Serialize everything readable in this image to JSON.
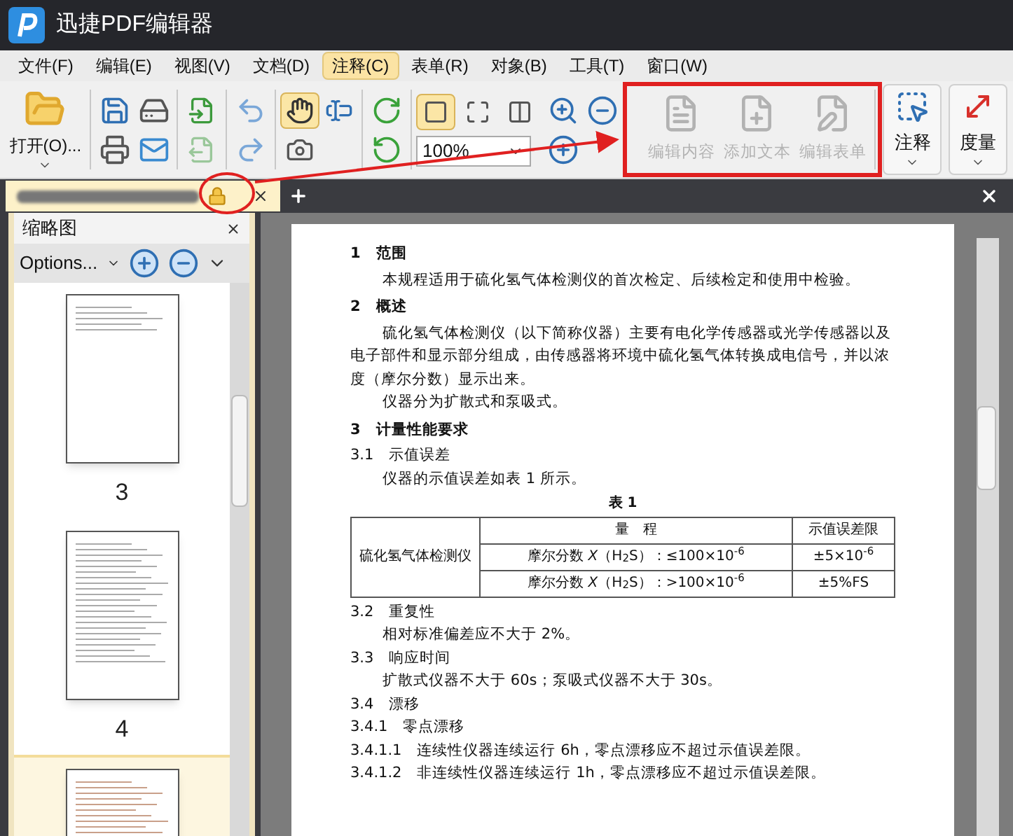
{
  "app": {
    "title": "迅捷PDF编辑器"
  },
  "menu": [
    {
      "label": "文件(F)",
      "selected": false
    },
    {
      "label": "编辑(E)",
      "selected": false
    },
    {
      "label": "视图(V)",
      "selected": false
    },
    {
      "label": "文档(D)",
      "selected": false
    },
    {
      "label": "注释(C)",
      "selected": true
    },
    {
      "label": "表单(R)",
      "selected": false
    },
    {
      "label": "对象(B)",
      "selected": false
    },
    {
      "label": "工具(T)",
      "selected": false
    },
    {
      "label": "窗口(W)",
      "selected": false
    }
  ],
  "toolbar": {
    "open_label": "打开(O)...",
    "zoom_value": "100%",
    "hand_selected": true,
    "actual_size_selected": true,
    "edit_buttons": [
      {
        "label": "编辑内容",
        "disabled": true
      },
      {
        "label": "添加文本",
        "disabled": true
      },
      {
        "label": "编辑表单",
        "disabled": true
      }
    ],
    "right_buttons": [
      {
        "label": "注释",
        "kind": "annotate"
      },
      {
        "label": "度量",
        "kind": "measure"
      }
    ]
  },
  "tab": {
    "locked": true
  },
  "sidebar": {
    "title": "缩略图",
    "options_label": "Options...",
    "thumbnails": [
      {
        "label": "3",
        "selected": false,
        "kind": "cover"
      },
      {
        "label": "4",
        "selected": false,
        "kind": "contents"
      },
      {
        "selected": true,
        "kind": "text"
      }
    ]
  },
  "document": {
    "blocks": [
      {
        "kind": "heading",
        "text": "1　范围"
      },
      {
        "kind": "para",
        "text": "本规程适用于硫化氢气体检测仪的首次检定、后续检定和使用中检验。"
      },
      {
        "kind": "heading",
        "text": "2　概述"
      },
      {
        "kind": "para",
        "text": "硫化氢气体检测仪（以下简称仪器）主要有电化学传感器或光学传感器以及电子部件和显示部分组成，由传感器将环境中硫化氢气体转换成电信号，并以浓度（摩尔分数）显示出来。"
      },
      {
        "kind": "para",
        "text": "仪器分为扩散式和泵吸式。"
      },
      {
        "kind": "heading",
        "text": "3　计量性能要求"
      },
      {
        "kind": "sub",
        "text": "3.1　示值误差"
      },
      {
        "kind": "para",
        "text": "仪器的示值误差如表 1 所示。"
      },
      {
        "kind": "table",
        "caption": "表 1",
        "header": [
          "量　程",
          "示值误差限"
        ],
        "row_label": "硫化氢气体检测仪",
        "rows": [
          [
            "摩尔分数 *X*（H$_{2}$S）：≤100×10$^{-6}$",
            "±5×10$^{-6}$"
          ],
          [
            "摩尔分数 *X*（H$_{2}$S）：>100×10$^{-6}$",
            "±5%FS"
          ]
        ]
      },
      {
        "kind": "sub",
        "text": "3.2　重复性"
      },
      {
        "kind": "para",
        "text": "相对标准偏差应不大于 2%。"
      },
      {
        "kind": "sub",
        "text": "3.3　响应时间"
      },
      {
        "kind": "para",
        "text": "扩散式仪器不大于 60s；泵吸式仪器不大于 30s。"
      },
      {
        "kind": "sub",
        "text": "3.4　漂移"
      },
      {
        "kind": "sub",
        "text": "3.4.1　零点漂移"
      },
      {
        "kind": "sub",
        "text": "3.4.1.1　连续性仪器连续运行 6h，零点漂移应不超过示值误差限。"
      },
      {
        "kind": "sub",
        "text": "3.4.1.2　非连续性仪器连续运行 1h，零点漂移应不超过示值误差限。"
      }
    ]
  }
}
